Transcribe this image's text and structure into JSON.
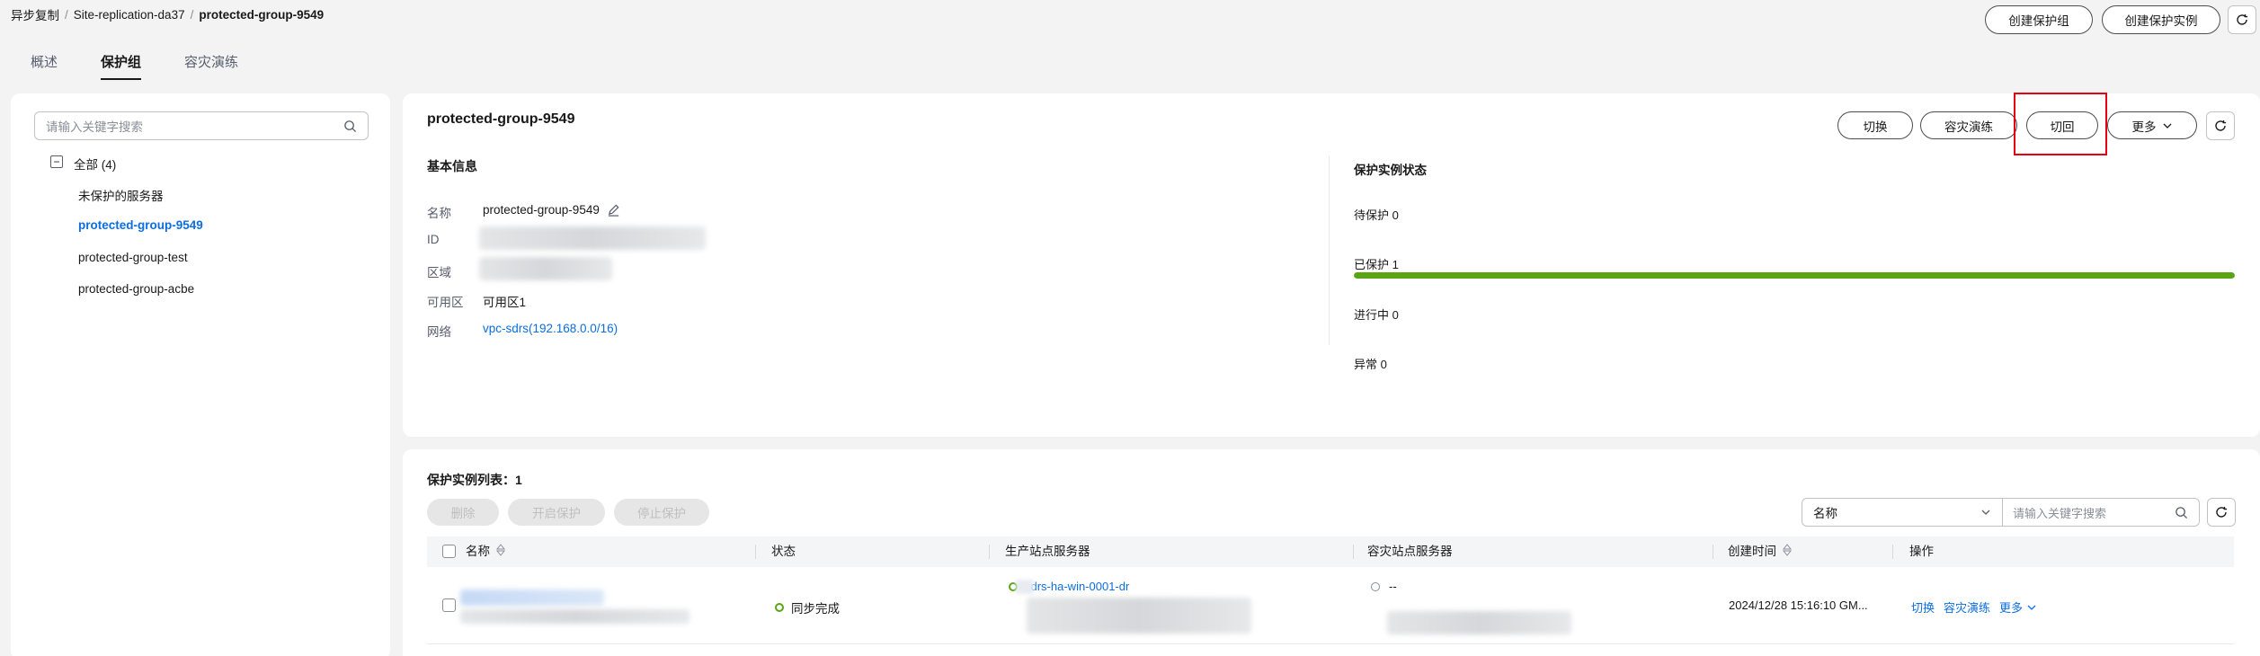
{
  "breadcrumb": {
    "item1": "异步复制",
    "item2": "Site-replication-da37",
    "current": "protected-group-9549",
    "sep": "/"
  },
  "header_buttons": {
    "create_group": "创建保护组",
    "create_instance": "创建保护实例"
  },
  "tabs": [
    {
      "label": "概述"
    },
    {
      "label": "保护组"
    },
    {
      "label": "容灾演练"
    }
  ],
  "sidebar": {
    "search_placeholder": "请输入关键字搜索",
    "root": "全部 (4)",
    "items": [
      {
        "label": "未保护的服务器"
      },
      {
        "label": "protected-group-9549"
      },
      {
        "label": "protected-group-test"
      },
      {
        "label": "protected-group-acbe"
      }
    ]
  },
  "detail": {
    "title": "protected-group-9549",
    "actions": {
      "switchover": "切换",
      "drill": "容灾演练",
      "failback": "切回",
      "more": "更多"
    },
    "basic_info": {
      "title": "基本信息",
      "name_label": "名称",
      "name_value": "protected-group-9549",
      "id_label": "ID",
      "region_label": "区域",
      "az_label": "可用区",
      "az_value": "可用区1",
      "network_label": "网络",
      "network_value": "vpc-sdrs(192.168.0.0/16)"
    },
    "instance_status": {
      "title": "保护实例状态",
      "pending": "待保护 0",
      "protected": "已保护 1",
      "protected_fraction": 1.0,
      "in_progress": "进行中 0",
      "abnormal": "异常 0"
    }
  },
  "instance_list": {
    "title": "保护实例列表：",
    "count": "1",
    "buttons": {
      "delete": "删除",
      "start": "开启保护",
      "stop": "停止保护"
    },
    "filter_select": "名称",
    "search_placeholder": "请输入关键字搜索",
    "columns": {
      "name": "名称",
      "status": "状态",
      "production": "生产站点服务器",
      "dr": "容灾站点服务器",
      "created": "创建时间",
      "ops": "操作"
    },
    "rows": [
      {
        "status": "同步完成",
        "production_server": "sdrs-ha-win-0001-dr",
        "dr_server": "--",
        "created": "2024/12/28 15:16:10 GM...",
        "op_switch": "切换",
        "op_drill": "容灾演练",
        "op_more": "更多"
      }
    ]
  },
  "colors": {
    "accent": "#0c6ee0",
    "success": "#5aa513",
    "highlight_border": "#e60012"
  }
}
